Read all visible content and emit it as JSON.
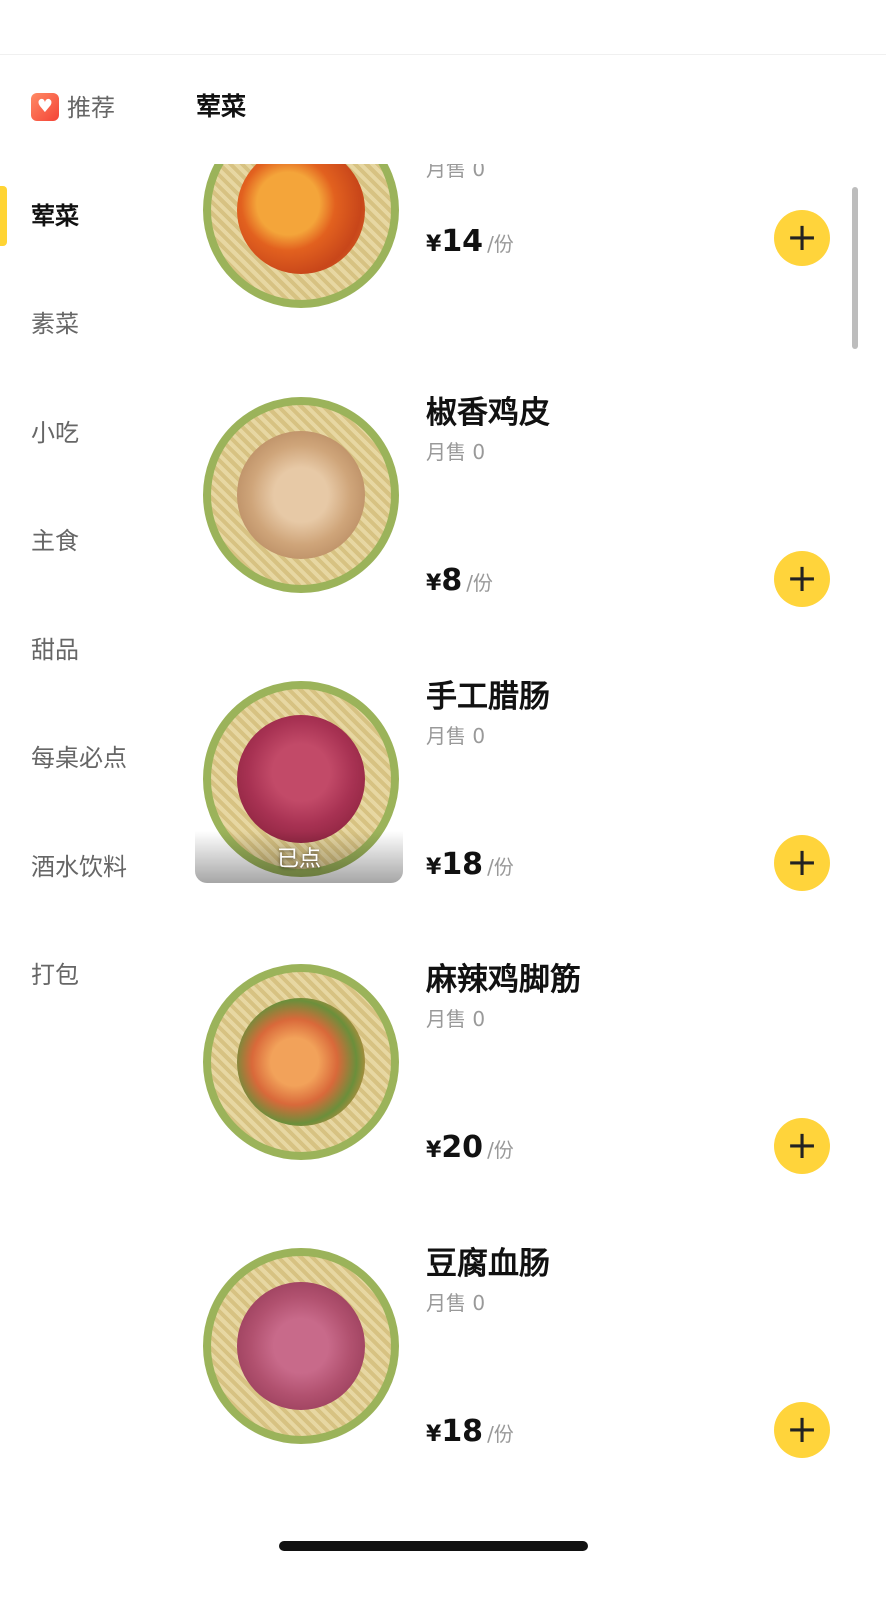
{
  "sidebar": {
    "recommend": {
      "icon": "heart-icon",
      "label": "推荐"
    },
    "items": [
      {
        "label": "荤菜"
      },
      {
        "label": "素菜"
      },
      {
        "label": "小吃"
      },
      {
        "label": "主食"
      },
      {
        "label": "甜品"
      },
      {
        "label": "每桌必点"
      },
      {
        "label": "酒水饮料"
      },
      {
        "label": "打包"
      }
    ],
    "active_color": "#ffd433"
  },
  "section": {
    "title": "荤菜"
  },
  "dishes": [
    {
      "name": "",
      "sales": "月售 0",
      "currency": "¥",
      "price": "14",
      "unit": "/份",
      "ordered_label": ""
    },
    {
      "name": "椒香鸡皮",
      "sales": "月售 0",
      "currency": "¥",
      "price": "8",
      "unit": "/份",
      "ordered_label": ""
    },
    {
      "name": "手工腊肠",
      "sales": "月售 0",
      "currency": "¥",
      "price": "18",
      "unit": "/份",
      "ordered_label": "已点"
    },
    {
      "name": "麻辣鸡脚筋",
      "sales": "月售 0",
      "currency": "¥",
      "price": "20",
      "unit": "/份",
      "ordered_label": ""
    },
    {
      "name": "豆腐血肠",
      "sales": "月售 0",
      "currency": "¥",
      "price": "18",
      "unit": "/份",
      "ordered_label": ""
    }
  ],
  "add_button": {
    "icon": "plus-icon",
    "symbol": "+",
    "color": "#ffd43b"
  }
}
